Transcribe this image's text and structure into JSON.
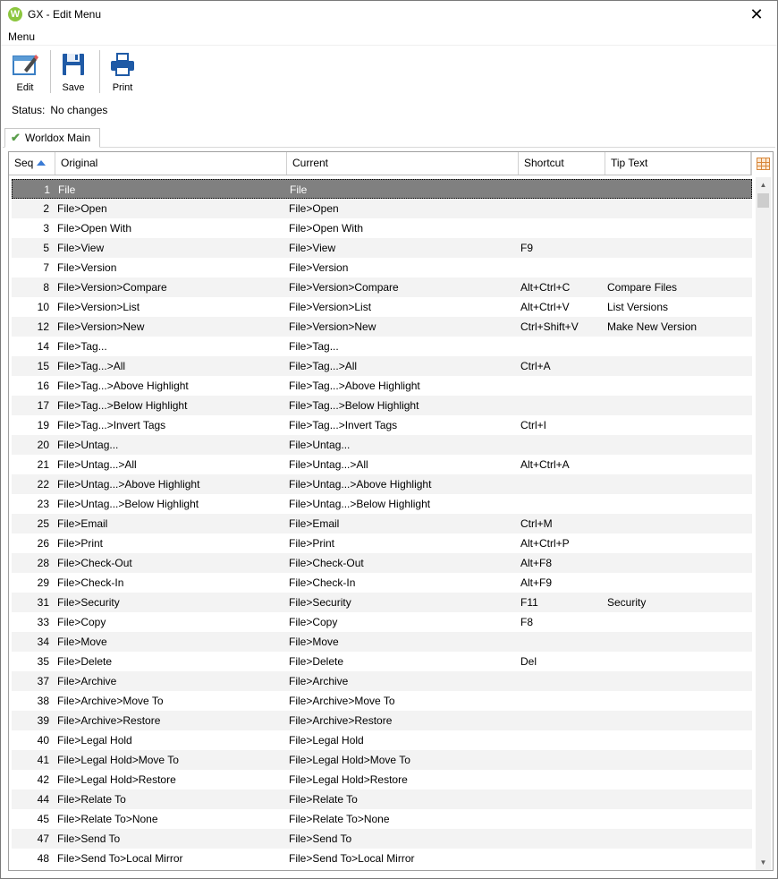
{
  "window": {
    "app_icon_letter": "W",
    "title": "GX - Edit Menu",
    "close_glyph": "✕"
  },
  "menubar": {
    "menu_label": "Menu"
  },
  "toolbar": {
    "edit_label": "Edit",
    "save_label": "Save",
    "print_label": "Print"
  },
  "status": {
    "label": "Status:",
    "value": "No changes"
  },
  "tabs": [
    {
      "label": "Worldox Main",
      "icon": "checkmark-icon"
    }
  ],
  "grid": {
    "columns": [
      "Seq",
      "Original",
      "Current",
      "Shortcut",
      "Tip Text"
    ],
    "sort_column": "Seq",
    "sort_direction": "ascending",
    "selected_seq": "1",
    "rows": [
      [
        "1",
        "File",
        "File",
        "",
        ""
      ],
      [
        "2",
        "File>Open",
        "File>Open",
        "",
        ""
      ],
      [
        "3",
        "File>Open With",
        "File>Open With",
        "",
        ""
      ],
      [
        "5",
        "File>View",
        "File>View",
        "F9",
        ""
      ],
      [
        "7",
        "File>Version",
        "File>Version",
        "",
        ""
      ],
      [
        "8",
        "File>Version>Compare",
        "File>Version>Compare",
        "Alt+Ctrl+C",
        "Compare Files"
      ],
      [
        "10",
        "File>Version>List",
        "File>Version>List",
        "Alt+Ctrl+V",
        "List Versions"
      ],
      [
        "12",
        "File>Version>New",
        "File>Version>New",
        "Ctrl+Shift+V",
        "Make New Version"
      ],
      [
        "14",
        "File>Tag...",
        "File>Tag...",
        "",
        ""
      ],
      [
        "15",
        "File>Tag...>All",
        "File>Tag...>All",
        "Ctrl+A",
        ""
      ],
      [
        "16",
        "File>Tag...>Above Highlight",
        "File>Tag...>Above Highlight",
        "",
        ""
      ],
      [
        "17",
        "File>Tag...>Below Highlight",
        "File>Tag...>Below Highlight",
        "",
        ""
      ],
      [
        "19",
        "File>Tag...>Invert Tags",
        "File>Tag...>Invert Tags",
        "Ctrl+I",
        ""
      ],
      [
        "20",
        "File>Untag...",
        "File>Untag...",
        "",
        ""
      ],
      [
        "21",
        "File>Untag...>All",
        "File>Untag...>All",
        "Alt+Ctrl+A",
        ""
      ],
      [
        "22",
        "File>Untag...>Above Highlight",
        "File>Untag...>Above Highlight",
        "",
        ""
      ],
      [
        "23",
        "File>Untag...>Below Highlight",
        "File>Untag...>Below Highlight",
        "",
        ""
      ],
      [
        "25",
        "File>Email",
        "File>Email",
        "Ctrl+M",
        ""
      ],
      [
        "26",
        "File>Print",
        "File>Print",
        "Alt+Ctrl+P",
        ""
      ],
      [
        "28",
        "File>Check-Out",
        "File>Check-Out",
        "Alt+F8",
        ""
      ],
      [
        "29",
        "File>Check-In",
        "File>Check-In",
        "Alt+F9",
        ""
      ],
      [
        "31",
        "File>Security",
        "File>Security",
        "F11",
        "Security"
      ],
      [
        "33",
        "File>Copy",
        "File>Copy",
        "F8",
        ""
      ],
      [
        "34",
        "File>Move",
        "File>Move",
        "",
        ""
      ],
      [
        "35",
        "File>Delete",
        "File>Delete",
        "Del",
        ""
      ],
      [
        "37",
        "File>Archive",
        "File>Archive",
        "",
        ""
      ],
      [
        "38",
        "File>Archive>Move To",
        "File>Archive>Move To",
        "",
        ""
      ],
      [
        "39",
        "File>Archive>Restore",
        "File>Archive>Restore",
        "",
        ""
      ],
      [
        "40",
        "File>Legal Hold",
        "File>Legal Hold",
        "",
        ""
      ],
      [
        "41",
        "File>Legal Hold>Move To",
        "File>Legal Hold>Move To",
        "",
        ""
      ],
      [
        "42",
        "File>Legal Hold>Restore",
        "File>Legal Hold>Restore",
        "",
        ""
      ],
      [
        "44",
        "File>Relate To",
        "File>Relate To",
        "",
        ""
      ],
      [
        "45",
        "File>Relate To>None",
        "File>Relate To>None",
        "",
        ""
      ],
      [
        "47",
        "File>Send To",
        "File>Send To",
        "",
        ""
      ],
      [
        "48",
        "File>Send To>Local Mirror",
        "File>Send To>Local Mirror",
        "",
        ""
      ]
    ]
  },
  "scrollbar": {
    "up_glyph": "▲",
    "down_glyph": "▼"
  }
}
